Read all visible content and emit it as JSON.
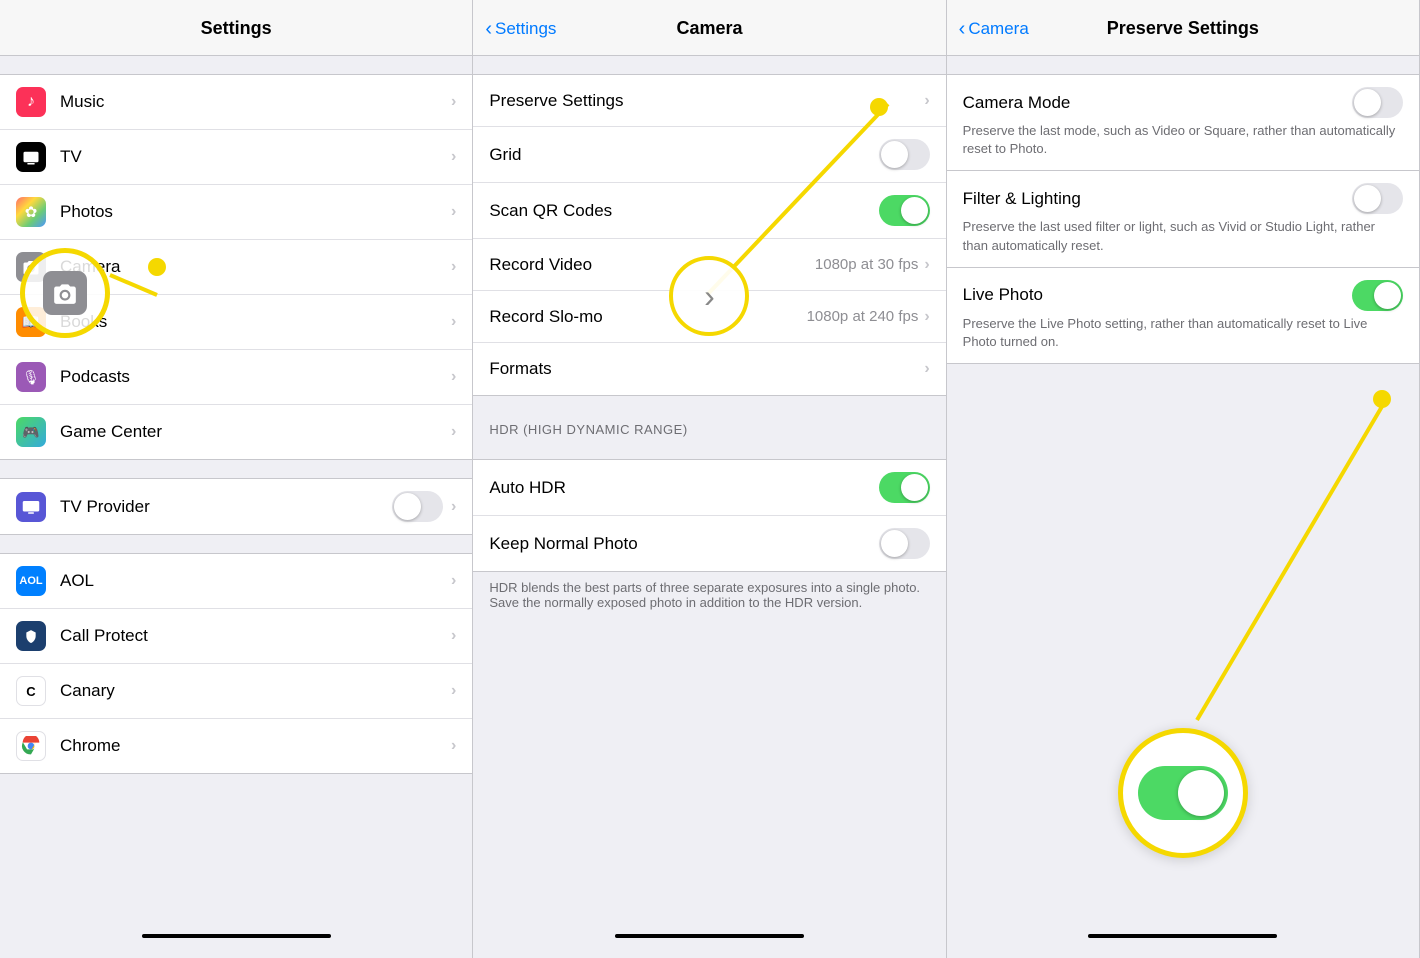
{
  "panel1": {
    "title": "Settings",
    "items": [
      {
        "label": "Music",
        "icon": "music",
        "iconBg": "#fc3158",
        "iconColor": "#fff",
        "hasChevron": true
      },
      {
        "label": "TV",
        "icon": "tv",
        "iconBg": "#000000",
        "iconColor": "#fff",
        "hasChevron": true
      },
      {
        "label": "Photos",
        "icon": "photos",
        "iconBg": "gradient",
        "iconColor": "#fff",
        "hasChevron": true
      },
      {
        "label": "Camera",
        "icon": "camera",
        "iconBg": "#8e8e93",
        "iconColor": "#fff",
        "hasChevron": true,
        "annotated": true
      },
      {
        "label": "Books",
        "icon": "books",
        "iconBg": "#ff8c00",
        "iconColor": "#fff",
        "hasChevron": true
      },
      {
        "label": "Podcasts",
        "icon": "podcasts",
        "iconBg": "#9b59b6",
        "iconColor": "#fff",
        "hasChevron": true
      },
      {
        "label": "Game Center",
        "icon": "gamecenter",
        "iconBg": "gradient2",
        "iconColor": "#fff",
        "hasChevron": true
      }
    ],
    "items2": [
      {
        "label": "TV Provider",
        "icon": "tvprovider",
        "iconBg": "#5856d6",
        "iconColor": "#fff",
        "hasChevron": true,
        "hasToggle": true
      }
    ],
    "items3": [
      {
        "label": "AOL",
        "icon": "aol",
        "iconBg": "#0080ff",
        "iconColor": "#fff",
        "hasChevron": true
      },
      {
        "label": "Call Protect",
        "icon": "callprotect",
        "iconBg": "#1c3f6e",
        "iconColor": "#fff",
        "hasChevron": true
      },
      {
        "label": "Canary",
        "icon": "canary",
        "iconBg": "#fff",
        "iconColor": "#000",
        "hasChevron": true
      },
      {
        "label": "Chrome",
        "icon": "chrome",
        "iconBg": "#fff",
        "iconColor": "#000",
        "hasChevron": true
      }
    ]
  },
  "panel2": {
    "title": "Camera",
    "backLabel": "Settings",
    "items": [
      {
        "label": "Preserve Settings",
        "hasChevron": true,
        "toggle": null,
        "annotated": true
      },
      {
        "label": "Grid",
        "hasChevron": false,
        "toggle": "off"
      },
      {
        "label": "Scan QR Codes",
        "hasChevron": false,
        "toggle": "on"
      },
      {
        "label": "Record Video",
        "value": "1080p at 30 fps",
        "hasChevron": true,
        "toggle": null
      },
      {
        "label": "Record Slo-mo",
        "value": "1080p at 240 fps",
        "hasChevron": true,
        "toggle": null
      },
      {
        "label": "Formats",
        "hasChevron": true,
        "toggle": null
      }
    ],
    "sectionHeader": "HDR (HIGH DYNAMIC RANGE)",
    "items2": [
      {
        "label": "Auto HDR",
        "toggle": "on"
      },
      {
        "label": "Keep Normal Photo",
        "toggle": "off"
      }
    ],
    "hdrDesc": "HDR blends the best parts of three separate exposures into a single photo. Save the normally exposed photo in addition to the HDR version."
  },
  "panel3": {
    "title": "Preserve Settings",
    "backLabel": "Camera",
    "items": [
      {
        "label": "Camera Mode",
        "toggle": "off",
        "desc": "Preserve the last mode, such as Video or Square, rather than automatically reset to Photo."
      },
      {
        "label": "Filter & Lighting",
        "toggle": "off",
        "desc": "Preserve the last used filter or light, such as Vivid or Studio Light, rather than automatically reset."
      },
      {
        "label": "Live Photo",
        "toggle": "on",
        "desc": "Preserve the Live Photo setting, rather than automatically reset to Live Photo turned on.",
        "annotated": true
      }
    ]
  }
}
